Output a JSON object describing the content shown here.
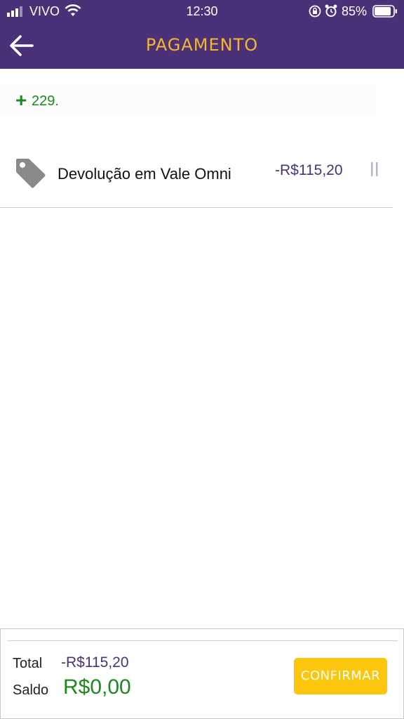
{
  "status_bar": {
    "carrier": "VIVO",
    "time": "12:30",
    "battery_percent": "85%",
    "icons": [
      "signal-icon",
      "wifi-icon",
      "orientation-lock-icon",
      "alarm-icon",
      "battery-icon"
    ],
    "background_color": "#4b3278"
  },
  "header": {
    "title": "PAGAMENTO",
    "back_icon": "arrow-left-icon",
    "title_color": "#f6b52f"
  },
  "add_row": {
    "plus_symbol": "+",
    "value": "229."
  },
  "payment_items": [
    {
      "icon": "tag-icon",
      "label": "Devolução em Vale Omni",
      "amount": "-R$115,20",
      "handle_icon": "drag-handle-icon"
    }
  ],
  "footer": {
    "total_label": "Total",
    "total_value": "-R$115,20",
    "saldo_label": "Saldo",
    "saldo_value": "R$0,00",
    "confirm_label": "CONFIRMAR",
    "confirm_color": "#fbc60c",
    "saldo_color": "#1e8a1e"
  }
}
